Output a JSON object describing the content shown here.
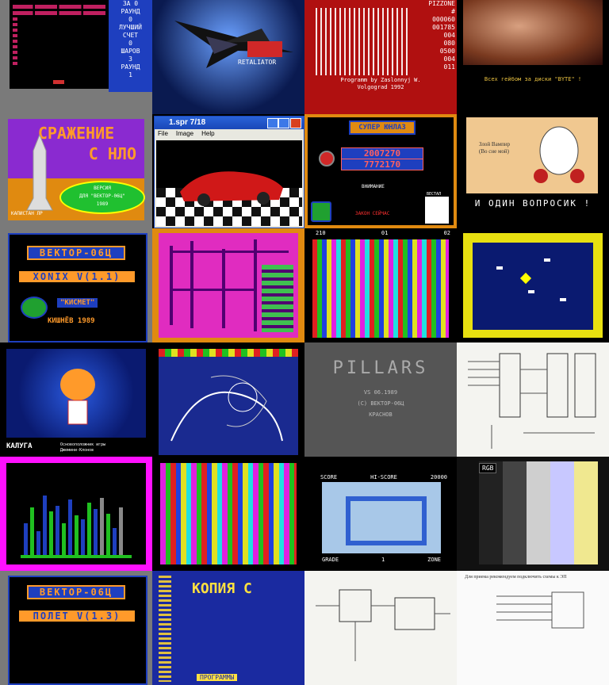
{
  "colors": {
    "bg": "#000000",
    "gray": "#7a7a7a",
    "vector_blue": "#1e3fbf",
    "vector_orange": "#ff9a2a"
  },
  "tile1": {
    "lines": [
      "ЗА 0",
      "РАУНД",
      "0",
      "ЛУЧШИЙ",
      "СЧЕТ",
      "0",
      "ШАРОВ",
      "3",
      "РАУНД",
      "1"
    ]
  },
  "tile2": {
    "caption": "RETALIATOR"
  },
  "tile3": {
    "header": "PIZZONE",
    "stats": [
      "#",
      "000060",
      "001785",
      "004",
      "080",
      "0500",
      "004",
      "011"
    ],
    "footer": [
      "Programm by Zaslonnyj W.",
      "Volgograd 1992"
    ]
  },
  "tile4": {
    "footer": "Всех гейбом за диски \"BYTE\" !"
  },
  "tile5": {
    "title_line1": "СРАЖЕНИЕ",
    "title_line2": "С НЛО",
    "oval": [
      "ВЕРСИЯ",
      "ДЛЯ \"ВЕКТОР-06Ц\"",
      "1989"
    ],
    "bottom": "КАПИСТАН ЛР"
  },
  "tile6": {
    "title": "1.spr  7/18",
    "menu": [
      "File",
      "Image",
      "Help"
    ]
  },
  "tile7": {
    "logo": "СУПЕР ЮНЛАЗ",
    "digits1": "2007270",
    "digits2": "7772170",
    "label": "ВНИМАНИЕ",
    "red_text": "ЗАКОН СЕЙЧАС",
    "name_label": "ВЕСТАЛ"
  },
  "tile8": {
    "sign": [
      "Злой Вампир",
      "(Во сне мой)"
    ],
    "bottom": "И ОДИН ВОПРОСИК !"
  },
  "tile9": {
    "title": "ВЕКТОР-06Ц",
    "game": "XONIX V(1.1)",
    "studio": "\"КИСМЕТ\"",
    "credit": "КИШНЁВ 1989"
  },
  "tile11": {
    "top": [
      "210",
      "01",
      "02"
    ]
  },
  "tile13": {
    "bottom": "КАЛУГА",
    "sub": "Основоположник игры Джемини-Клонов"
  },
  "tile15": {
    "title": "PILLARS",
    "lines": [
      "VS 06.1989",
      "(C) ВЕКТОР-06Ц",
      "КРАСНОВ"
    ]
  },
  "tile18": {},
  "tile19": {
    "score": "SCORE",
    "hiscore": "HI-SCORE",
    "hiscore_val": "20000",
    "grade": "GRADE",
    "lives": "1",
    "zone": "ZONE"
  },
  "tile20": {
    "badge": "RGB"
  },
  "tile21": {
    "title": "ВЕКТОР-06Ц",
    "game": "ПОЛЕТ V(1.3)"
  },
  "tile22": {
    "header": "КОПИЯ С",
    "sub": "ПРОГРАММЫ"
  },
  "tile24": {
    "header": "Для приема рекомендуем подключить схемы к ЭП"
  }
}
